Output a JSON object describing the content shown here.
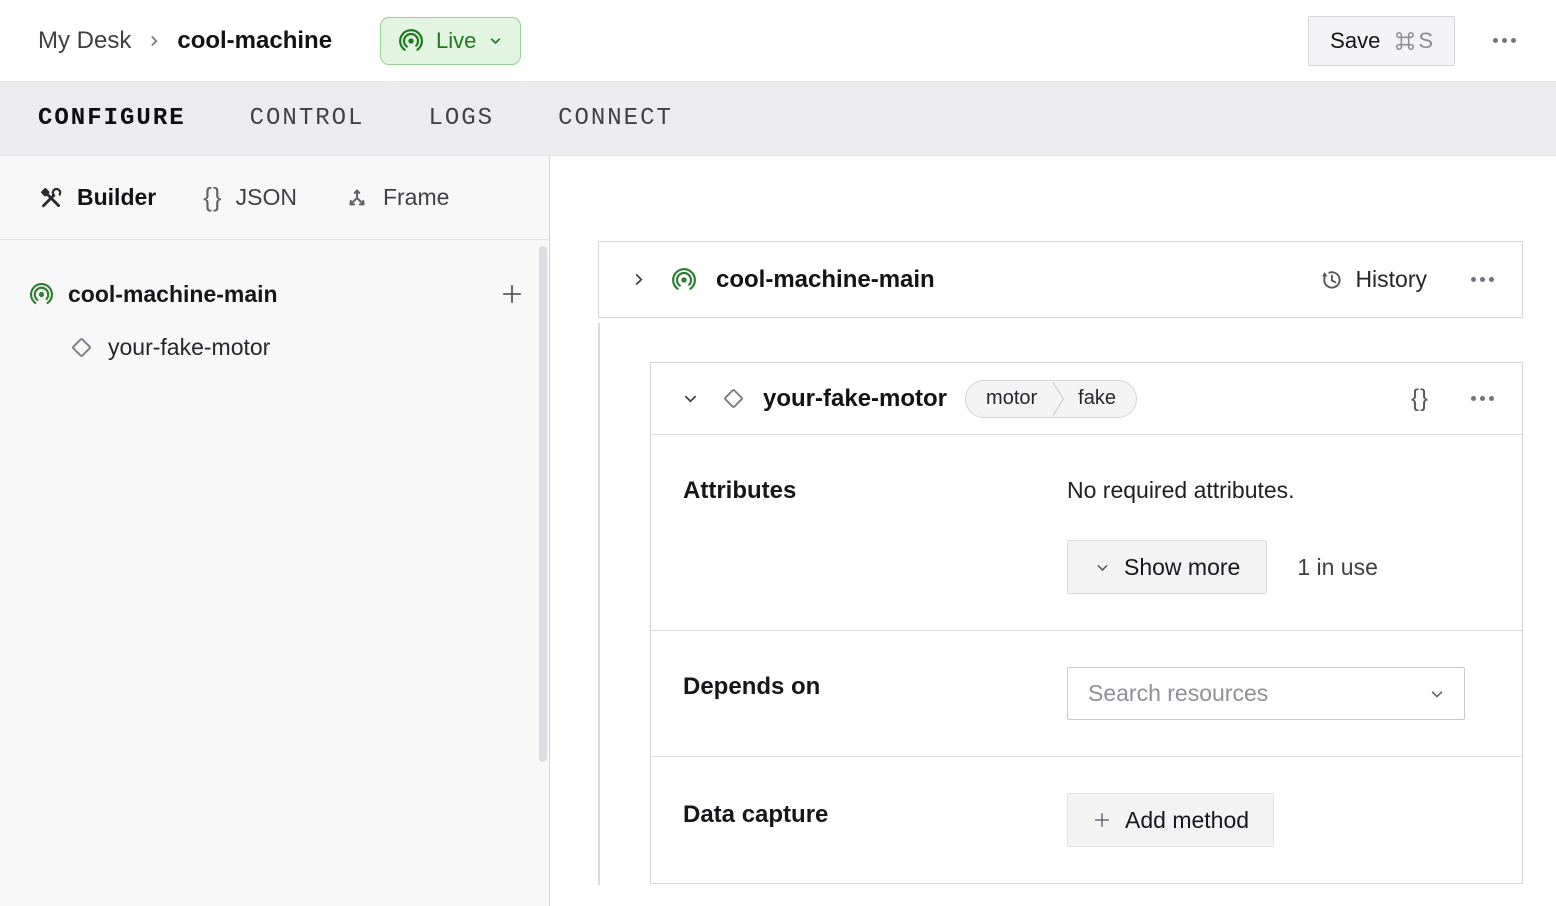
{
  "header": {
    "breadcrumb": {
      "parent": "My Desk",
      "current": "cool-machine"
    },
    "live_badge": {
      "label": "Live"
    },
    "save_button": {
      "label": "Save",
      "shortcut_key": "S"
    }
  },
  "nav_tabs": [
    {
      "label": "CONFIGURE",
      "active": true
    },
    {
      "label": "CONTROL",
      "active": false
    },
    {
      "label": "LOGS",
      "active": false
    },
    {
      "label": "CONNECT",
      "active": false
    }
  ],
  "sidebar": {
    "view_tabs": [
      {
        "label": "Builder",
        "icon": "tools-icon",
        "active": true
      },
      {
        "label": "JSON",
        "icon": "braces-icon",
        "glyph": "{}",
        "active": false
      },
      {
        "label": "Frame",
        "icon": "frame-axes-icon",
        "active": false
      }
    ],
    "tree": {
      "machine": {
        "label": "cool-machine-main"
      },
      "components": [
        {
          "label": "your-fake-motor"
        }
      ]
    }
  },
  "main": {
    "machine_card": {
      "title": "cool-machine-main",
      "history_label": "History"
    },
    "component_card": {
      "title": "your-fake-motor",
      "type_badge": {
        "type": "motor",
        "model": "fake"
      },
      "json_icon_glyph": "{}",
      "attributes": {
        "label": "Attributes",
        "message": "No required attributes.",
        "show_more_label": "Show more",
        "usage_text": "1 in use"
      },
      "depends_on": {
        "label": "Depends on",
        "placeholder": "Search resources"
      },
      "data_capture": {
        "label": "Data capture",
        "add_method_label": "Add method"
      }
    }
  },
  "colors": {
    "live_badge_bg": "#e1f5e1",
    "live_badge_border": "#96d196",
    "live_badge_text": "#1f7a1f",
    "brand_green": "#2e7d32",
    "tab_bar_bg": "#ececef",
    "sidebar_bg": "#f8f8f9",
    "card_border": "#d6d6da"
  }
}
